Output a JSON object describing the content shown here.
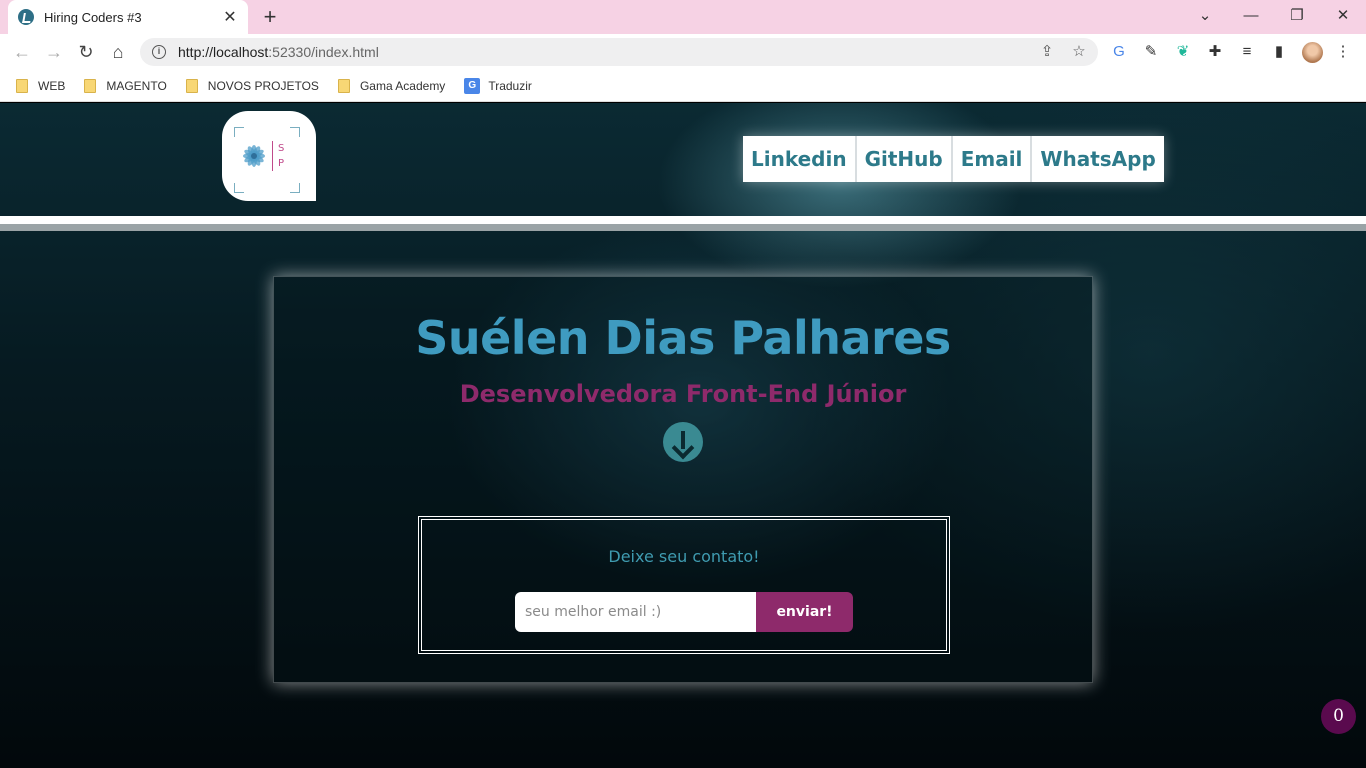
{
  "browser": {
    "tab_title": "Hiring Coders #3",
    "new_tab_label": "+",
    "url_host": "http://localhost",
    "url_rest": ":52330/index.html",
    "bookmarks": [
      {
        "label": "WEB",
        "icon": "folder-icon"
      },
      {
        "label": "MAGENTO",
        "icon": "folder-icon"
      },
      {
        "label": "NOVOS PROJETOS",
        "icon": "folder-icon"
      },
      {
        "label": "Gama Academy",
        "icon": "folder-icon"
      },
      {
        "label": "Traduzir",
        "icon": "google-translate-icon"
      }
    ]
  },
  "header": {
    "logo_letters": [
      "S",
      "P"
    ],
    "nav": [
      "Linkedin",
      "GitHub",
      "Email",
      "WhatsApp"
    ]
  },
  "hero": {
    "name": "Suélen Dias Palhares",
    "role": "Desenvolvedora Front-End Júnior"
  },
  "contact": {
    "title": "Deixe seu contato!",
    "email_placeholder": "seu melhor email :)",
    "submit_label": "enviar!"
  },
  "badge": {
    "count": "0"
  },
  "colors": {
    "accent_blue": "#3f9bc0",
    "accent_magenta": "#8e2a6b",
    "nav_text": "#2d7a8a",
    "badge": "#5a0a4e"
  }
}
